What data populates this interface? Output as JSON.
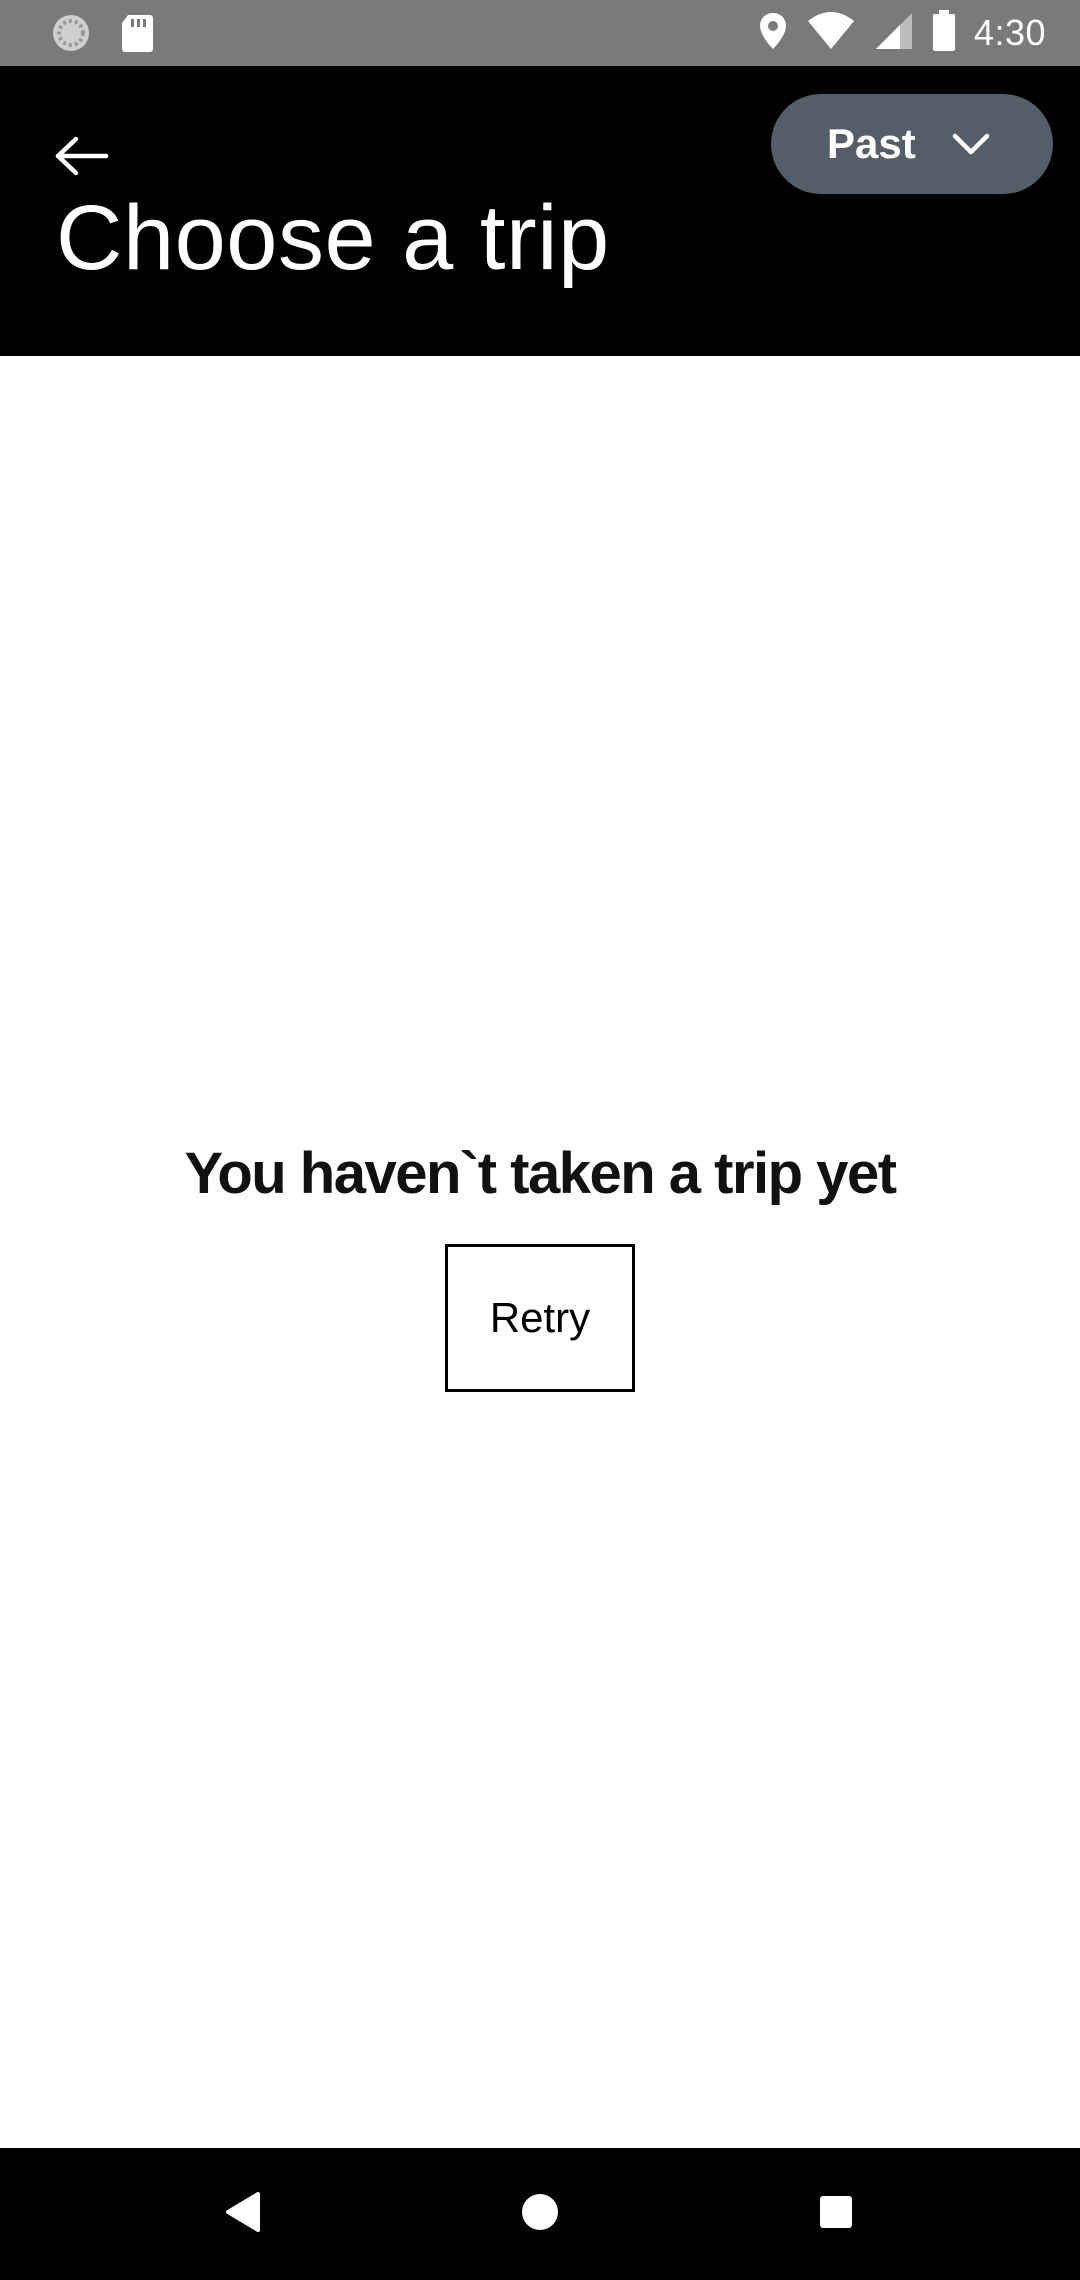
{
  "status_bar": {
    "time": "4:30",
    "icons": [
      "sync-icon",
      "sd-card-icon",
      "location-icon",
      "wifi-icon",
      "signal-icon",
      "battery-icon"
    ]
  },
  "header": {
    "back_icon": "arrow-left-icon",
    "title": "Choose a trip",
    "filter": {
      "selected": "Past",
      "icon": "chevron-down-icon"
    }
  },
  "main": {
    "empty_message": "You haven`t taken a trip yet",
    "retry_label": "Retry"
  },
  "nav_bar": {
    "icons": [
      "back-triangle-icon",
      "home-circle-icon",
      "recents-square-icon"
    ]
  },
  "colors": {
    "status_bar_bg": "#7a7a7a",
    "header_bg": "#000000",
    "filter_bg": "#535e69",
    "page_bg": "#ffffff",
    "nav_bg": "#000000"
  }
}
